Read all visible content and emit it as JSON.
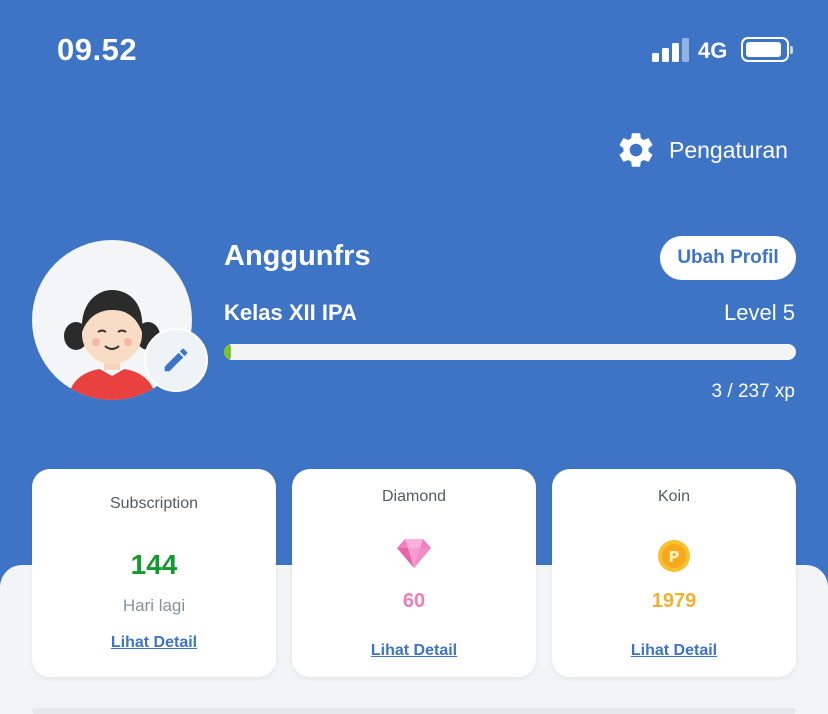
{
  "status_bar": {
    "time": "09.52",
    "network": "4G",
    "signal_bars": 3,
    "battery_icon": "battery-icon"
  },
  "settings": {
    "label": "Pengaturan",
    "icon": "gear-icon"
  },
  "profile": {
    "username": "Anggunfrs",
    "edit_button_label": "Ubah Profil",
    "kelas": "Kelas XII IPA",
    "level": "Level 5",
    "xp_text": "3 / 237 xp",
    "xp_progress": 0.013,
    "avatar_icon": "girl-avatar-icon",
    "edit_avatar_icon": "pencil-icon"
  },
  "cards": {
    "subscription": {
      "title": "Subscription",
      "value": "144",
      "subtitle": "Hari lagi",
      "link": "Lihat Detail"
    },
    "diamond": {
      "title": "Diamond",
      "icon": "diamond-icon",
      "value": "60",
      "link": "Lihat Detail"
    },
    "koin": {
      "title": "Koin",
      "icon": "coin-icon",
      "value": "1979",
      "link": "Lihat Detail"
    }
  },
  "colors": {
    "header_bg": "#3d74c6",
    "progress": "#7ac12a",
    "subscription_value": "#129b2c",
    "diamond_value": "#ec7fb7",
    "coin_value": "#f0b330",
    "link": "#3d74c6"
  }
}
